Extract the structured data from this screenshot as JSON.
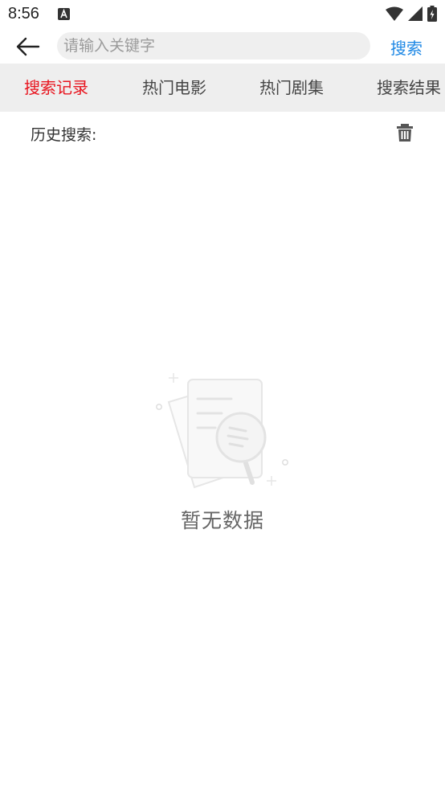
{
  "status_bar": {
    "time": "8:56"
  },
  "header": {
    "search_placeholder": "请输入关键字",
    "search_button": "搜索"
  },
  "tabs": [
    {
      "label": "搜索记录",
      "active": true
    },
    {
      "label": "热门电影",
      "active": false
    },
    {
      "label": "热门剧集",
      "active": false
    },
    {
      "label": "搜索结果",
      "active": false
    }
  ],
  "history": {
    "title": "历史搜索:"
  },
  "empty_state": {
    "text": "暂无数据"
  },
  "colors": {
    "accent_red": "#e8141e",
    "link_blue": "#1e88e5",
    "tab_bar_bg": "#eeeeee"
  },
  "icons": [
    "back-arrow-icon",
    "trash-icon",
    "wifi-icon",
    "signal-icon",
    "battery-icon",
    "notification-a-icon",
    "empty-document-search-icon"
  ]
}
